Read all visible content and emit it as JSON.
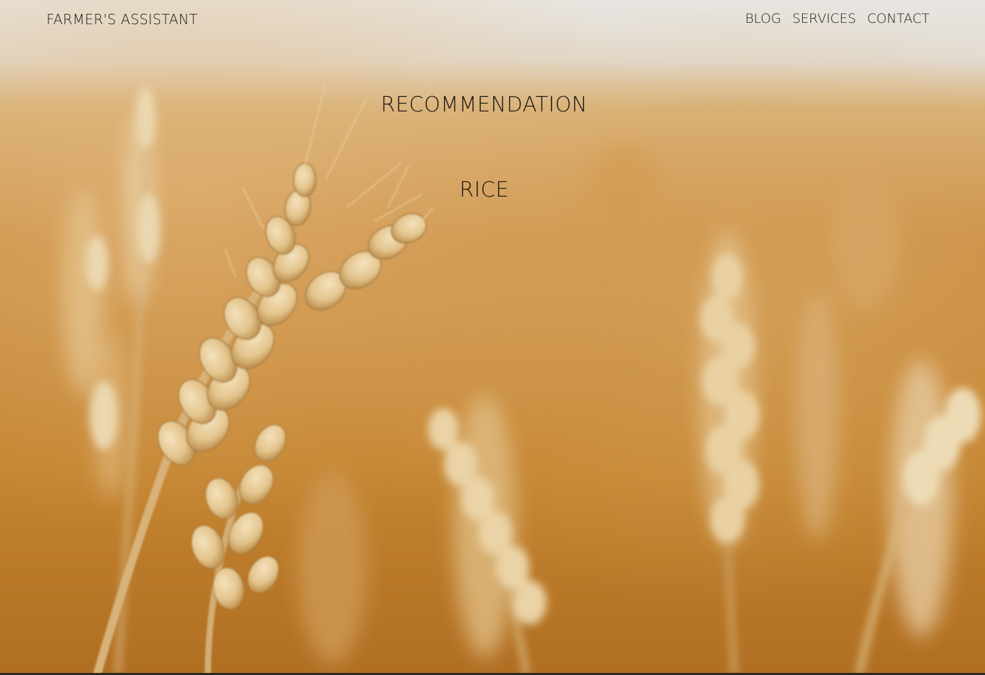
{
  "header": {
    "brand": "FARMER'S ASSISTANT",
    "nav": [
      {
        "label": "BLOG"
      },
      {
        "label": "SERVICES"
      },
      {
        "label": "CONTACT"
      }
    ]
  },
  "main": {
    "heading": "RECOMMENDATION",
    "result": "RICE"
  },
  "background": {
    "image": "wheat-field-photo",
    "colors": {
      "sky": "#e6e3de",
      "field_light": "#d9a45a",
      "field_mid": "#c88733",
      "field_dark": "#a8661d",
      "grain": "#ecd3a0"
    }
  }
}
